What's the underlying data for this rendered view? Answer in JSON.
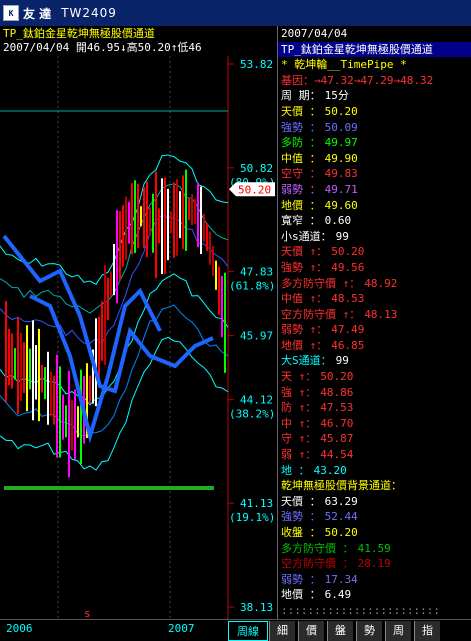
{
  "titlebar": {
    "icon": "chart-app-icon",
    "name": "友  達",
    "code": "TW2409"
  },
  "chart_header": {
    "line1": "TP_鈦鉑金星乾坤無極股價通道",
    "line2": "2007/04/04 開46.95↓高50.20↑低46"
  },
  "price_axis": {
    "ticks": [
      {
        "v": 53.82,
        "pct": ""
      },
      {
        "v": 50.82,
        "pct": "(80.9%)"
      },
      {
        "v": 47.83,
        "pct": "(61.8%)"
      },
      {
        "v": 45.97,
        "pct": ""
      },
      {
        "v": 44.12,
        "pct": "(38.2%)"
      },
      {
        "v": 41.13,
        "pct": "(19.1%)"
      },
      {
        "v": 38.13,
        "pct": ""
      }
    ],
    "current": "50.20"
  },
  "right_panel": {
    "rows": [
      {
        "label": "2007/04/04",
        "value": "",
        "lc": "#ffffff",
        "vc": "#ffffff"
      },
      {
        "label": "TP_鈦鉑金星乾坤無極股價通道",
        "value": "",
        "lc": "#ffffff",
        "vc": "#ffffff",
        "bar": true
      },
      {
        "label": "  * 乾坤輪__TimePipe *",
        "value": "",
        "lc": "#ffff00",
        "vc": "#ffff00"
      },
      {
        "label": "基因：→47.32→47.29→48.32",
        "value": "",
        "lc": "#ff3030",
        "vc": "#ff3030"
      },
      {
        "label": "周   期：",
        "value": "15分",
        "lc": "#ffffff",
        "vc": "#ffffff"
      },
      {
        "label": "天價  ：",
        "value": "50.20",
        "lc": "#ffff00",
        "vc": "#ffff00"
      },
      {
        "label": "強勢  ：",
        "value": "50.09",
        "lc": "#6f6fff",
        "vc": "#6f6fff"
      },
      {
        "label": "多防  ：",
        "value": "49.97",
        "lc": "#00ff00",
        "vc": "#00ff00"
      },
      {
        "label": "中值  ：",
        "value": "49.90",
        "lc": "#ffff00",
        "vc": "#ffff00"
      },
      {
        "label": "空守  ：",
        "value": "49.83",
        "lc": "#ff3030",
        "vc": "#ff3030"
      },
      {
        "label": "弱勢  ：",
        "value": "49.71",
        "lc": "#c060ff",
        "vc": "#c060ff"
      },
      {
        "label": "地價  ：",
        "value": "49.60",
        "lc": "#ffff00",
        "vc": "#ffff00"
      },
      {
        "label": "寬窄  ：",
        "value": "0.60",
        "lc": "#ffffff",
        "vc": "#ffffff"
      },
      {
        "label": "小s通道：",
        "value": "99",
        "lc": "#ffffff",
        "vc": "#ffffff"
      },
      {
        "label": "天價 ↑：",
        "value": "50.20",
        "lc": "#ff3030",
        "vc": "#ff3030"
      },
      {
        "label": "強勢 ↑：",
        "value": "49.56",
        "lc": "#ff3030",
        "vc": "#ff3030"
      },
      {
        "label": "多方防守價 ↑：",
        "value": "48.92",
        "lc": "#ff3030",
        "vc": "#ff3030"
      },
      {
        "label": "中值 ↑：",
        "value": "48.53",
        "lc": "#ff3030",
        "vc": "#ff3030"
      },
      {
        "label": "空方防守價 ↑：",
        "value": "48.13",
        "lc": "#ff3030",
        "vc": "#ff3030"
      },
      {
        "label": "弱勢 ↑：",
        "value": "47.49",
        "lc": "#ff3030",
        "vc": "#ff3030"
      },
      {
        "label": "地價 ↑：",
        "value": "46.85",
        "lc": "#ff3030",
        "vc": "#ff3030"
      },
      {
        "label": "大S通道：",
        "value": "99",
        "lc": "#00ffff",
        "vc": "#ffffff"
      },
      {
        "label": "天 ↑：",
        "value": "50.20",
        "lc": "#ff3030",
        "vc": "#ff3030"
      },
      {
        "label": "強 ↑：",
        "value": "48.86",
        "lc": "#ff3030",
        "vc": "#ff3030"
      },
      {
        "label": "防 ↑：",
        "value": "47.53",
        "lc": "#ff3030",
        "vc": "#ff3030"
      },
      {
        "label": "中 ↑：",
        "value": "46.70",
        "lc": "#ff3030",
        "vc": "#ff3030"
      },
      {
        "label": "守 ↑：",
        "value": "45.87",
        "lc": "#ff3030",
        "vc": "#ff3030"
      },
      {
        "label": "弱 ↑：",
        "value": "44.54",
        "lc": "#ff3030",
        "vc": "#ff3030"
      },
      {
        "label": "地  ：",
        "value": "43.20",
        "lc": "#00ffff",
        "vc": "#00ffff"
      },
      {
        "label": "乾坤無極股價背景通道：",
        "value": "",
        "lc": "#ffff00",
        "vc": "#ffff00"
      },
      {
        "label": "天價  ：",
        "value": "63.29",
        "lc": "#ffffff",
        "vc": "#ffffff"
      },
      {
        "label": "強勢  ：",
        "value": "52.44",
        "lc": "#6f6fff",
        "vc": "#6f6fff"
      },
      {
        "label": "收盤  ：",
        "value": "50.20",
        "lc": "#ffff00",
        "vc": "#ffff00"
      },
      {
        "label": "多方防守價 ：",
        "value": "41.59",
        "lc": "#00c000",
        "vc": "#00c000"
      },
      {
        "label": "空方防守價 ：",
        "value": "28.19",
        "lc": "#c00000",
        "vc": "#c00000"
      },
      {
        "label": "弱勢  ：",
        "value": "17.34",
        "lc": "#6f6fff",
        "vc": "#6f6fff"
      },
      {
        "label": "地價  ：",
        "value": "6.49",
        "lc": "#ffffff",
        "vc": "#ffffff"
      },
      {
        "label": " ::::::::::::::::::::::::",
        "value": "",
        "lc": "#888888",
        "vc": "#888888"
      }
    ]
  },
  "bottom": {
    "years": [
      "2006",
      "2007"
    ],
    "marker": "s",
    "tabs": [
      {
        "label": "周線",
        "active": true
      },
      {
        "label": "細"
      },
      {
        "label": "價"
      },
      {
        "label": "盤"
      },
      {
        "label": "勢"
      },
      {
        "label": "周"
      },
      {
        "label": "指"
      }
    ]
  },
  "colors": {
    "up": "#ff3030",
    "down": "#00ffff",
    "channel": "#1e64ff",
    "support": "#22aa22"
  }
}
